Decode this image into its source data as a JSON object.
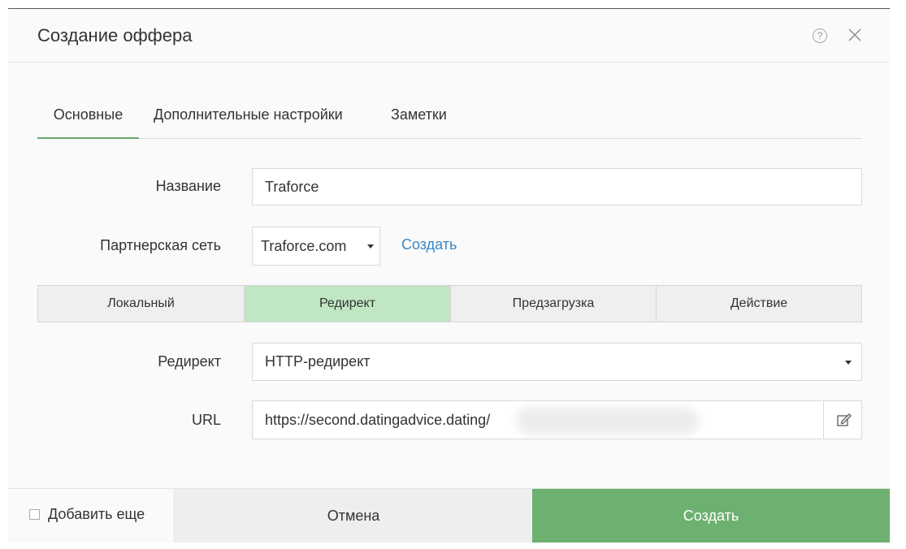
{
  "dialog": {
    "title": "Создание оффера",
    "help_icon": "question-circle-icon",
    "close_icon": "close-icon"
  },
  "tabs": [
    {
      "label": "Основные",
      "active": true
    },
    {
      "label": "Дополнительные настройки",
      "active": false
    },
    {
      "label": "Заметки",
      "active": false
    }
  ],
  "form": {
    "name_label": "Название",
    "name_value": "Traforce",
    "network_label": "Партнерская сеть",
    "network_value": "Traforce.com",
    "network_create_link": "Создать",
    "redirect_label": "Редирект",
    "redirect_value": "HTTP-редирект",
    "url_label": "URL",
    "url_value": "https://second.datingadvice.dating/"
  },
  "segments": [
    {
      "label": "Локальный",
      "active": false
    },
    {
      "label": "Редирект",
      "active": true
    },
    {
      "label": "Предзагрузка",
      "active": false
    },
    {
      "label": "Действие",
      "active": false
    }
  ],
  "footer": {
    "add_more_label": "Добавить еще",
    "add_more_checked": false,
    "cancel_label": "Отмена",
    "create_label": "Создать"
  },
  "colors": {
    "accent_green": "#6db06f",
    "segment_active": "#c0e6c3",
    "link_blue": "#3a88c5"
  }
}
